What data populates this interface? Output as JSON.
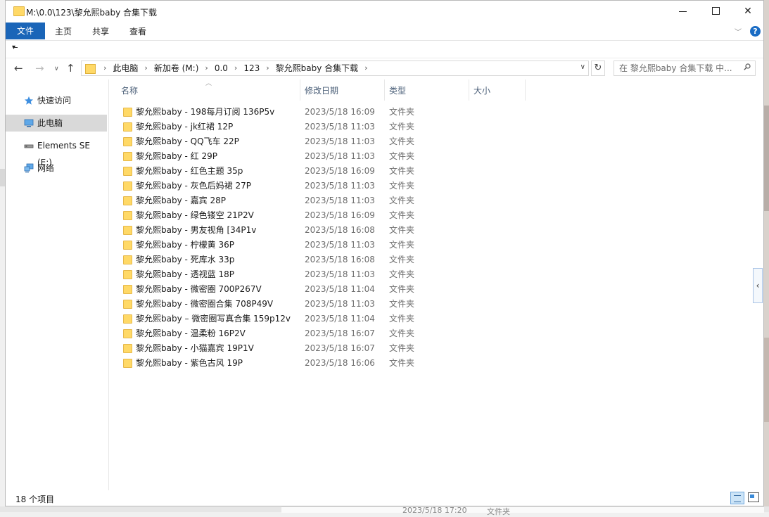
{
  "window": {
    "title": "M:\\0.0\\123\\黎允熙baby 合集下载"
  },
  "ribbon": {
    "tabs": [
      "文件",
      "主页",
      "共享",
      "查看"
    ]
  },
  "address": {
    "crumbs": [
      "此电脑",
      "新加卷 (M:)",
      "0.0",
      "123",
      "黎允熙baby 合集下载"
    ]
  },
  "search": {
    "placeholder": "在 黎允熙baby 合集下载 中..."
  },
  "navpane": {
    "items": [
      {
        "label": "快速访问",
        "icon": "star-icon"
      },
      {
        "label": "此电脑",
        "icon": "computer-icon",
        "selected": true
      },
      {
        "label": "Elements SE (E:)",
        "icon": "drive-icon"
      },
      {
        "label": "网络",
        "icon": "network-icon"
      }
    ]
  },
  "columns": {
    "name": "名称",
    "date": "修改日期",
    "type": "类型",
    "size": "大小"
  },
  "files": [
    {
      "name": "黎允熙baby - 198每月订阅 136P5v",
      "date": "2023/5/18 16:09",
      "type": "文件夹"
    },
    {
      "name": "黎允熙baby - jk红裙 12P",
      "date": "2023/5/18 11:03",
      "type": "文件夹"
    },
    {
      "name": "黎允熙baby - QQ飞车 22P",
      "date": "2023/5/18 11:03",
      "type": "文件夹"
    },
    {
      "name": "黎允熙baby - 红 29P",
      "date": "2023/5/18 11:03",
      "type": "文件夹"
    },
    {
      "name": "黎允熙baby - 红色主题 35p",
      "date": "2023/5/18 16:09",
      "type": "文件夹"
    },
    {
      "name": "黎允熙baby - 灰色后妈裙 27P",
      "date": "2023/5/18 11:03",
      "type": "文件夹"
    },
    {
      "name": "黎允熙baby - 嘉宾 28P",
      "date": "2023/5/18 11:03",
      "type": "文件夹"
    },
    {
      "name": "黎允熙baby - 绿色镂空 21P2V",
      "date": "2023/5/18 16:09",
      "type": "文件夹"
    },
    {
      "name": "黎允熙baby - 男友视角 [34P1v",
      "date": "2023/5/18 16:08",
      "type": "文件夹"
    },
    {
      "name": "黎允熙baby - 柠檬黄 36P",
      "date": "2023/5/18 11:03",
      "type": "文件夹"
    },
    {
      "name": "黎允熙baby - 死库水 33p",
      "date": "2023/5/18 16:08",
      "type": "文件夹"
    },
    {
      "name": "黎允熙baby - 透视蓝 18P",
      "date": "2023/5/18 11:03",
      "type": "文件夹"
    },
    {
      "name": "黎允熙baby - 微密圈 700P267V",
      "date": "2023/5/18 11:04",
      "type": "文件夹"
    },
    {
      "name": "黎允熙baby - 微密圈合集 708P49V",
      "date": "2023/5/18 11:03",
      "type": "文件夹"
    },
    {
      "name": "黎允熙baby – 微密圈写真合集 159p12v",
      "date": "2023/5/18 11:04",
      "type": "文件夹"
    },
    {
      "name": "黎允熙baby - 温柔粉 16P2V",
      "date": "2023/5/18 16:07",
      "type": "文件夹"
    },
    {
      "name": "黎允熙baby - 小猫嘉宾 19P1V",
      "date": "2023/5/18 16:07",
      "type": "文件夹"
    },
    {
      "name": "黎允熙baby - 紫色古风 19P",
      "date": "2023/5/18 16:06",
      "type": "文件夹"
    }
  ],
  "status": {
    "count": "18 个项目"
  },
  "background": {
    "ghost_date": "2023/5/18 17:20",
    "ghost_type": "文件夹"
  },
  "colors": {
    "accent": "#1a65b8",
    "folder": "#ffd967",
    "header_text": "#4c6079"
  }
}
